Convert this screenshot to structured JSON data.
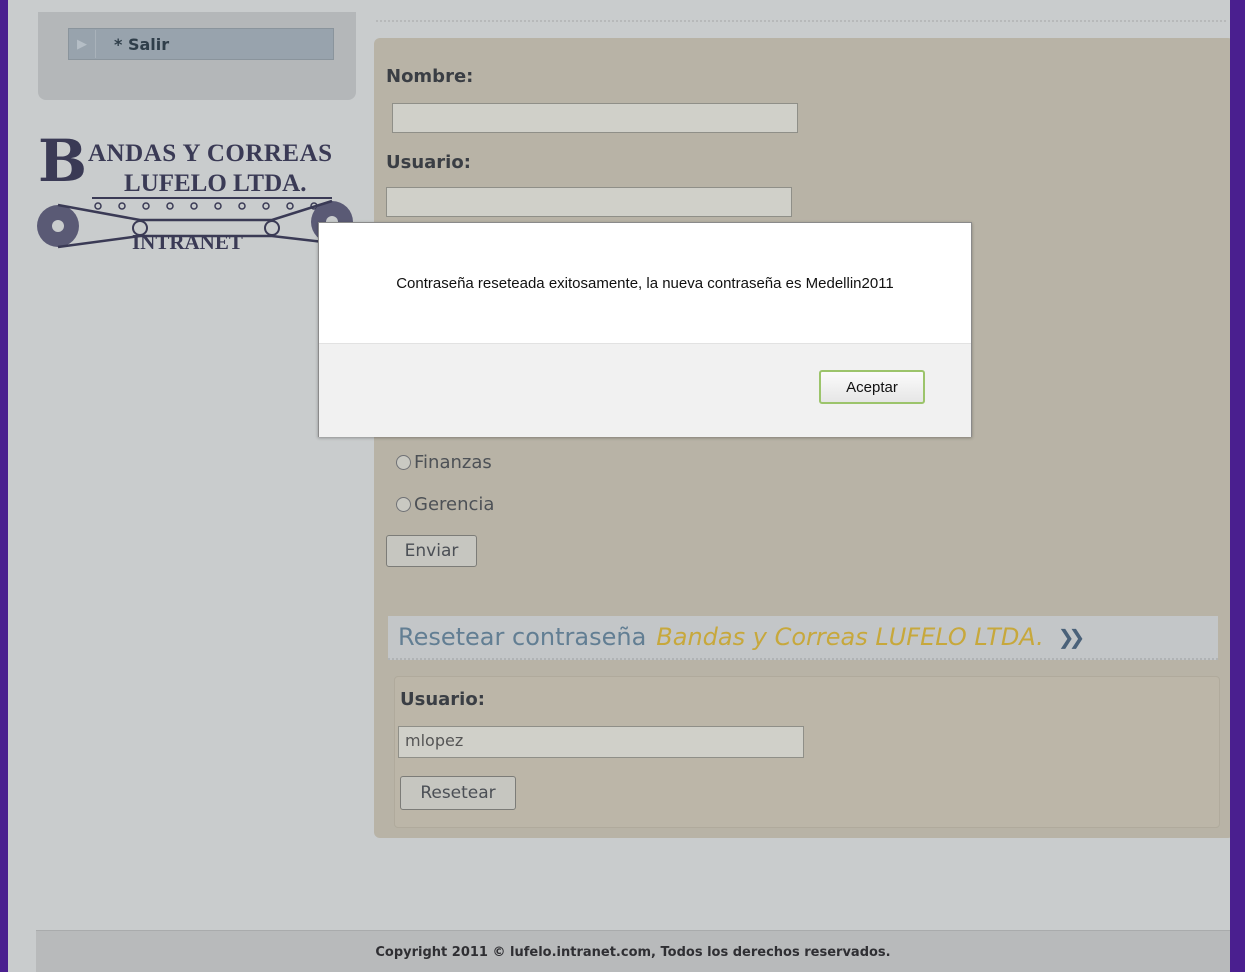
{
  "sidebar": {
    "menu_items": [
      {
        "label": "* Salir"
      }
    ],
    "logo": {
      "line1": "ANDAS Y CORREAS",
      "initial": "B",
      "line2": "LUFELO LTDA.",
      "line3": "INTRANET"
    }
  },
  "form": {
    "nombre_label": "Nombre:",
    "nombre_value": "",
    "usuario_label": "Usuario:",
    "usuario_value": "",
    "radio_options": [
      {
        "label": "Finanzas",
        "selected": false
      },
      {
        "label": "Gerencia",
        "selected": false
      }
    ],
    "submit_label": "Enviar"
  },
  "reset_section": {
    "title": "Resetear contraseña",
    "title_highlight": "Bandas y Correas LUFELO LTDA.",
    "usuario_label": "Usuario:",
    "usuario_value": "mlopez",
    "reset_label": "Resetear"
  },
  "dialog": {
    "message": "Contraseña reseteada exitosamente, la nueva contraseña es Medellin2011",
    "ok_label": "Aceptar"
  },
  "footer": {
    "copyright": "Copyright 2011 © lufelo.intranet.com, Todos los derechos reservados."
  },
  "colors": {
    "side_border": "#4a1f8f",
    "dialog_button_border": "#9cc46b",
    "highlight_gold": "#c7a83c"
  }
}
